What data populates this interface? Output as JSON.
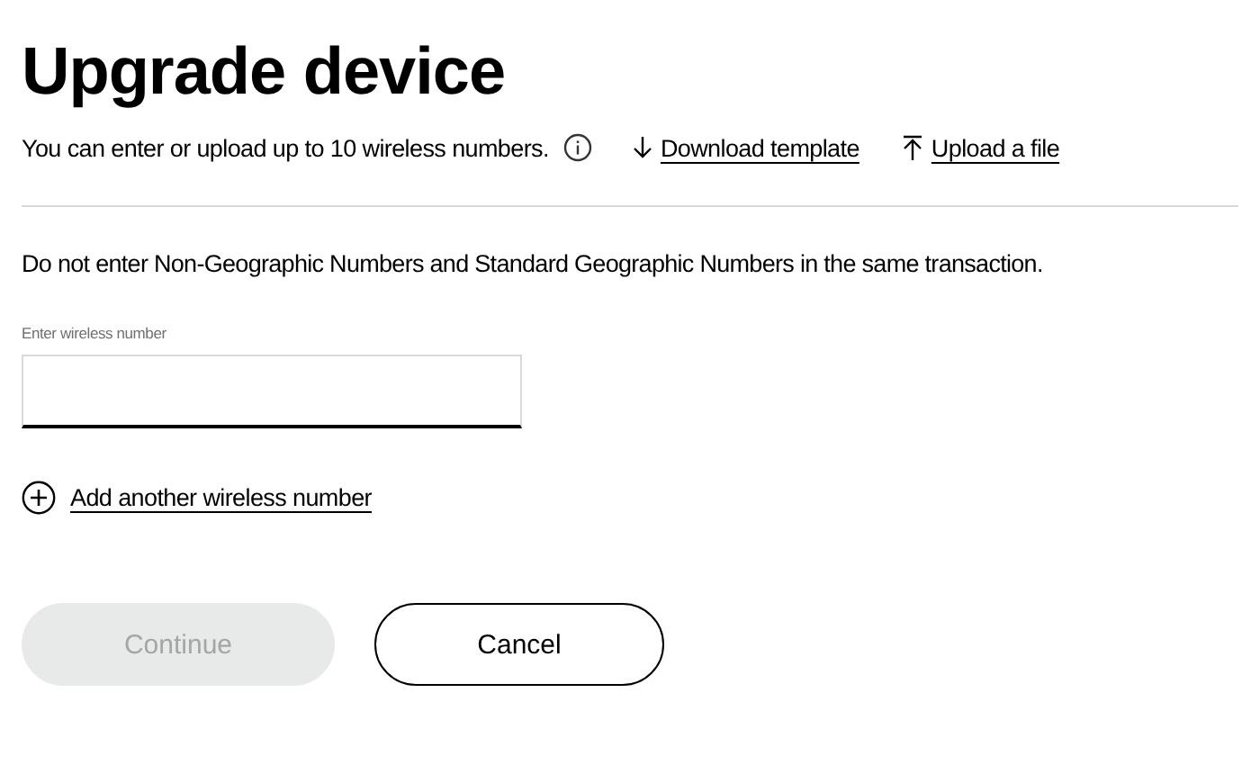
{
  "title": "Upgrade device",
  "intro": {
    "text": "You can enter or upload up to 10 wireless numbers.",
    "links": [
      {
        "kind": "download",
        "label": "Download template"
      },
      {
        "kind": "upload",
        "label": "Upload a file"
      }
    ]
  },
  "notice": "Do not enter Non-Geographic Numbers and Standard Geographic Numbers in the same transaction.",
  "field": {
    "label": "Enter wireless number"
  },
  "add_link": "Add another wireless number",
  "buttons": [
    {
      "label": "Continue",
      "kind": "primary",
      "disabled": true
    },
    {
      "label": "Cancel",
      "kind": "secondary",
      "disabled": false
    }
  ]
}
